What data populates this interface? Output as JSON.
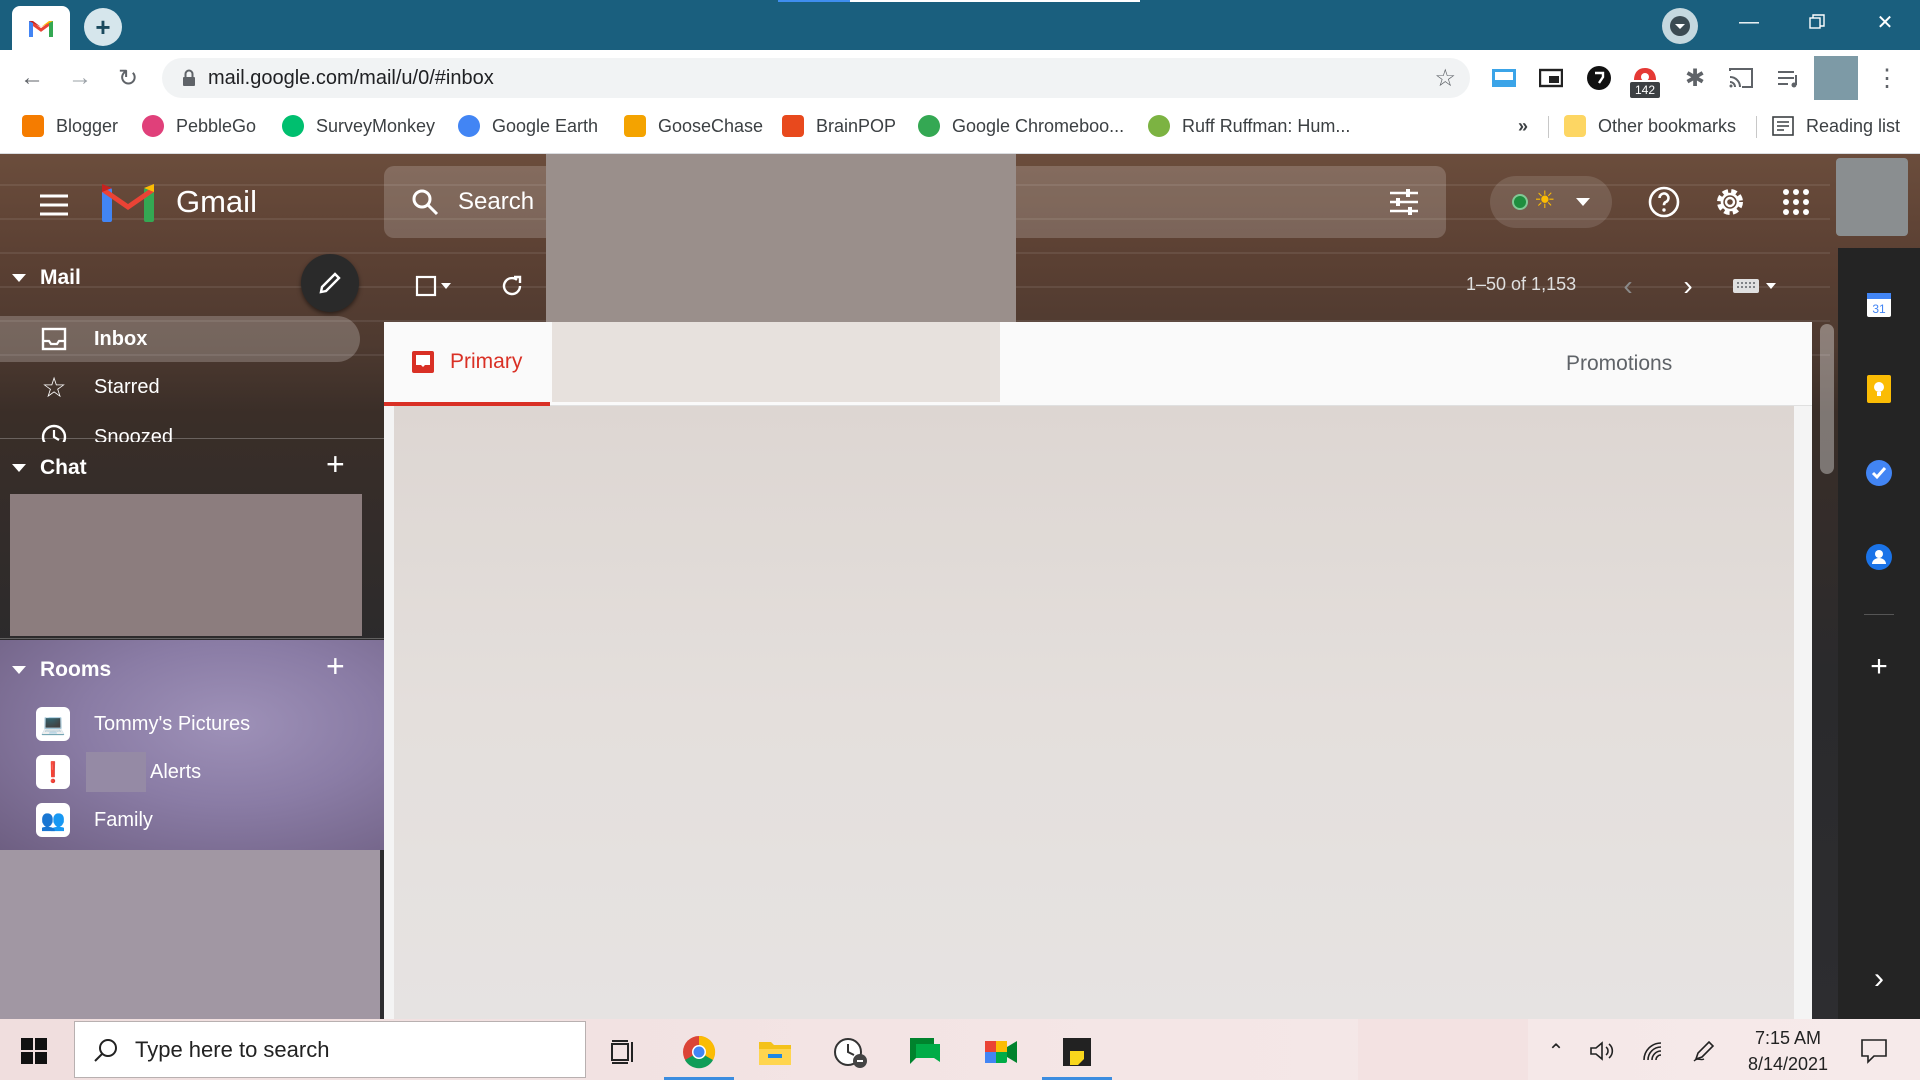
{
  "browser": {
    "tab_icon": "gmail-m-icon",
    "url": "mail.google.com/mail/u/0/#inbox",
    "extension_badge": "142",
    "bookmarks": [
      {
        "label": "Blogger",
        "color": "#f57c00"
      },
      {
        "label": "PebbleGo",
        "color": "#e0407a"
      },
      {
        "label": "SurveyMonkey",
        "color": "#00bf6f"
      },
      {
        "label": "Google Earth",
        "color": "#4285f4"
      },
      {
        "label": "GooseChase",
        "color": "#f4a300"
      },
      {
        "label": "BrainPOP",
        "color": "#e8491d"
      },
      {
        "label": "Google Chromeboo...",
        "color": "#34a853"
      },
      {
        "label": "Ruff Ruffman: Hum...",
        "color": "#7cb342"
      }
    ],
    "bookmarks_overflow": "»",
    "other_bookmarks": "Other bookmarks",
    "reading_list": "Reading list"
  },
  "gmail": {
    "brand": "Gmail",
    "search_placeholder": "Search",
    "sections": {
      "mail": "Mail",
      "chat": "Chat",
      "rooms": "Rooms"
    },
    "nav": [
      {
        "label": "Inbox",
        "icon": "inbox-icon"
      },
      {
        "label": "Starred",
        "icon": "star-icon"
      },
      {
        "label": "Snoozed",
        "icon": "clock-icon"
      }
    ],
    "rooms": [
      {
        "label": "Tommy's Pictures",
        "emoji": "💻"
      },
      {
        "label": "Alerts",
        "emoji": "❗"
      },
      {
        "label": "Family",
        "emoji": "👥"
      }
    ],
    "pager": "1–50 of 1,153",
    "tabs": {
      "primary": "Primary",
      "promotions": "Promotions"
    },
    "accent_red": "#d93025"
  },
  "taskbar": {
    "search_placeholder": "Type here to search",
    "time": "7:15 AM",
    "date": "8/14/2021"
  }
}
